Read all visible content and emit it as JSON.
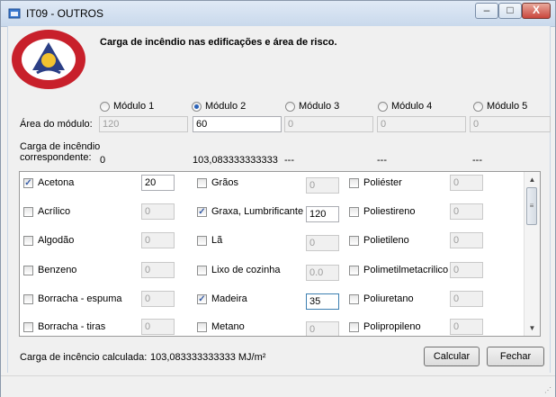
{
  "window": {
    "title": "IT09 - OUTROS"
  },
  "header": {
    "text": "Carga de incêndio nas edificações e área de risco.",
    "logo_text": "CORPO DE BOMBEIROS MILITAR MINAS GERAIS"
  },
  "modules": [
    {
      "label": "Módulo 1",
      "selected": false,
      "area": "120",
      "area_enabled": false,
      "carga": "0"
    },
    {
      "label": "Módulo 2",
      "selected": true,
      "area": "60",
      "area_enabled": true,
      "carga": "103,083333333333"
    },
    {
      "label": "Módulo 3",
      "selected": false,
      "area": "0",
      "area_enabled": false,
      "carga": "---"
    },
    {
      "label": "Módulo 4",
      "selected": false,
      "area": "0",
      "area_enabled": false,
      "carga": "---"
    },
    {
      "label": "Módulo 5",
      "selected": false,
      "area": "0",
      "area_enabled": false,
      "carga": "---"
    }
  ],
  "labels": {
    "area": "Área do módulo:",
    "carga_line1": "Carga de incêndio",
    "carga_line2": "correspondente:"
  },
  "materials": {
    "col1": [
      {
        "name": "Acetona",
        "checked": true,
        "value": "20",
        "enabled": true
      },
      {
        "name": "Acrílico",
        "checked": false,
        "value": "0",
        "enabled": false
      },
      {
        "name": "Algodão",
        "checked": false,
        "value": "0",
        "enabled": false
      },
      {
        "name": "Benzeno",
        "checked": false,
        "value": "0",
        "enabled": false
      },
      {
        "name": "Borracha - espuma",
        "checked": false,
        "value": "0",
        "enabled": false
      },
      {
        "name": "Borracha - tiras",
        "checked": false,
        "value": "0",
        "enabled": false
      }
    ],
    "col2": [
      {
        "name": "Grãos",
        "checked": false,
        "value": "0",
        "enabled": false
      },
      {
        "name": "Graxa, Lumbrificante",
        "checked": true,
        "value": "120",
        "enabled": true
      },
      {
        "name": "Lã",
        "checked": false,
        "value": "0",
        "enabled": false
      },
      {
        "name": "Lixo de cozinha",
        "checked": false,
        "value": "0.0",
        "enabled": false
      },
      {
        "name": "Madeira",
        "checked": true,
        "value": "35",
        "enabled": true
      },
      {
        "name": "Metano",
        "checked": false,
        "value": "0",
        "enabled": false
      }
    ],
    "col3": [
      {
        "name": "Poliéster",
        "checked": false,
        "value": "0",
        "enabled": false
      },
      {
        "name": "Poliestireno",
        "checked": false,
        "value": "0",
        "enabled": false
      },
      {
        "name": "Polietileno",
        "checked": false,
        "value": "0",
        "enabled": false
      },
      {
        "name": "Polimetilmetacrilico",
        "checked": false,
        "value": "0",
        "enabled": false
      },
      {
        "name": "Poliuretano",
        "checked": false,
        "value": "0",
        "enabled": false
      },
      {
        "name": "Polipropileno",
        "checked": false,
        "value": "0",
        "enabled": false
      }
    ]
  },
  "footer": {
    "result_label": "Carga de incêncio calculada:",
    "result_value": "103,083333333333 MJ/m²",
    "calcular": "Calcular",
    "fechar": "Fechar"
  },
  "colors": {
    "accent": "#2a62b8",
    "logo_red": "#c8202b"
  }
}
